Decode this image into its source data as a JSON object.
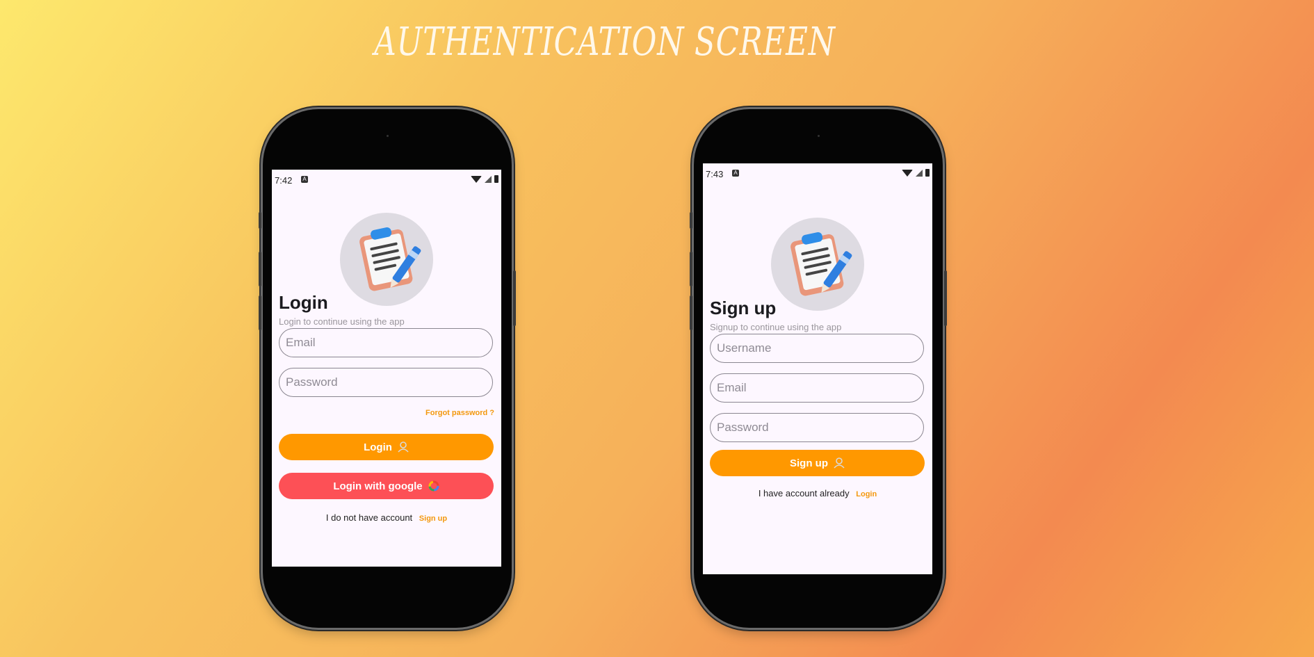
{
  "banner": {
    "title": "AUTHENTICATION SCREEN"
  },
  "colors": {
    "accent": "#ff9800",
    "google": "#fd5056",
    "link": "#f3980d",
    "screen": "#fdf7ff"
  },
  "login": {
    "status_time": "7:42",
    "title": "Login",
    "subtitle": "Login to continue using the app",
    "email_placeholder": "Email",
    "password_placeholder": "Password",
    "forgot_label": "Forgot password ?",
    "login_button": "Login",
    "google_button": "Login with google",
    "footer_text": "I do not have account",
    "footer_link": "Sign up"
  },
  "signup": {
    "status_time": "7:43",
    "title": "Sign up",
    "subtitle": "Signup to continue using the app",
    "username_placeholder": "Username",
    "email_placeholder": "Email",
    "password_placeholder": "Password",
    "signup_button": "Sign up",
    "footer_text": "I have account already",
    "footer_link": "Login"
  },
  "icons": {
    "avatar": "clipboard-pen-icon",
    "button": "user-icon",
    "google": "google-icon"
  }
}
